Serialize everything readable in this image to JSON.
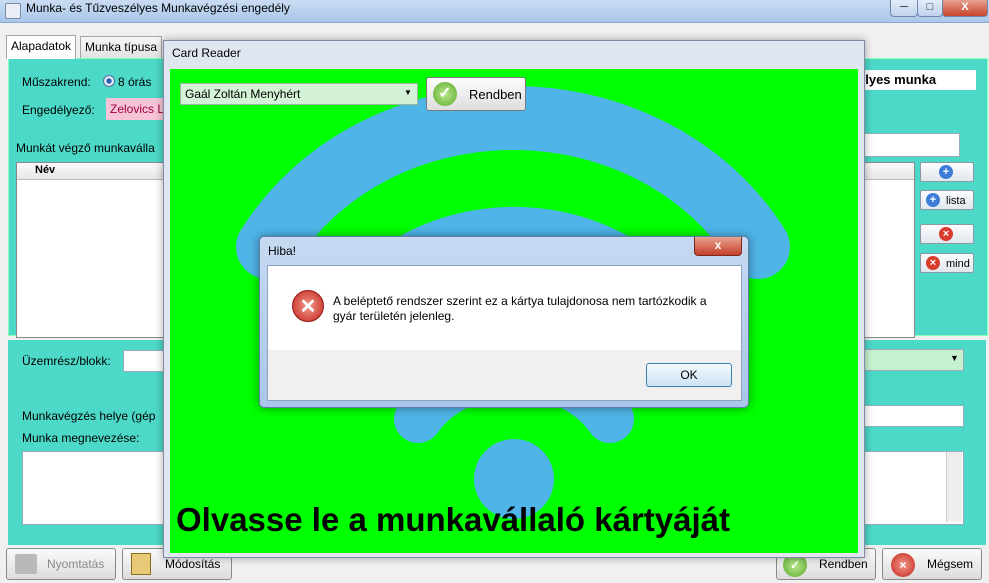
{
  "window": {
    "title": "Munka- és Tűzveszélyes Munkavégzési engedély",
    "controls": {
      "minimize": "─",
      "maximize": "□",
      "close": "X"
    }
  },
  "tabs": [
    {
      "label": "Alapadatok",
      "active": true
    },
    {
      "label": "Munka típusa",
      "active": false
    }
  ],
  "form": {
    "shift_label": "Műszakrend:",
    "shift_option": "8 órás",
    "approver_label": "Engedélyező:",
    "approver_value": "Zelovics L",
    "workers_label": "Munkát végző munkaválla",
    "grid_column_name": "Név",
    "right_title": "élyes munka",
    "plant_label": "Üzemrész/blokk:",
    "location_label": "Munkavégzés helye (gép",
    "work_name_label": "Munka megnevezése:"
  },
  "side_buttons": [
    {
      "label": "",
      "icon": "plus-icon"
    },
    {
      "label": "lista",
      "icon": "plus-icon"
    },
    {
      "label": "",
      "icon": "remove-icon"
    },
    {
      "label": "mind",
      "icon": "remove-icon"
    }
  ],
  "bottom_buttons": {
    "print": "Nyomtatás",
    "modify": "Módosítás",
    "ok": "Rendben",
    "cancel": "Mégsem"
  },
  "card_reader": {
    "title": "Card Reader",
    "selected_person": "Gaál Zoltán Menyhért",
    "ok_label": "Rendben",
    "prompt": "Olvasse le a munkavállaló kártyáját",
    "background_color": "#00ff00"
  },
  "error_dialog": {
    "title": "Hiba!",
    "message_line1": "A beléptető rendszer szerint ez a kártya tulajdonosa nem tartózkodik a",
    "message_line2": "gyár területén jelenleg.",
    "ok_label": "OK",
    "close": "x"
  }
}
